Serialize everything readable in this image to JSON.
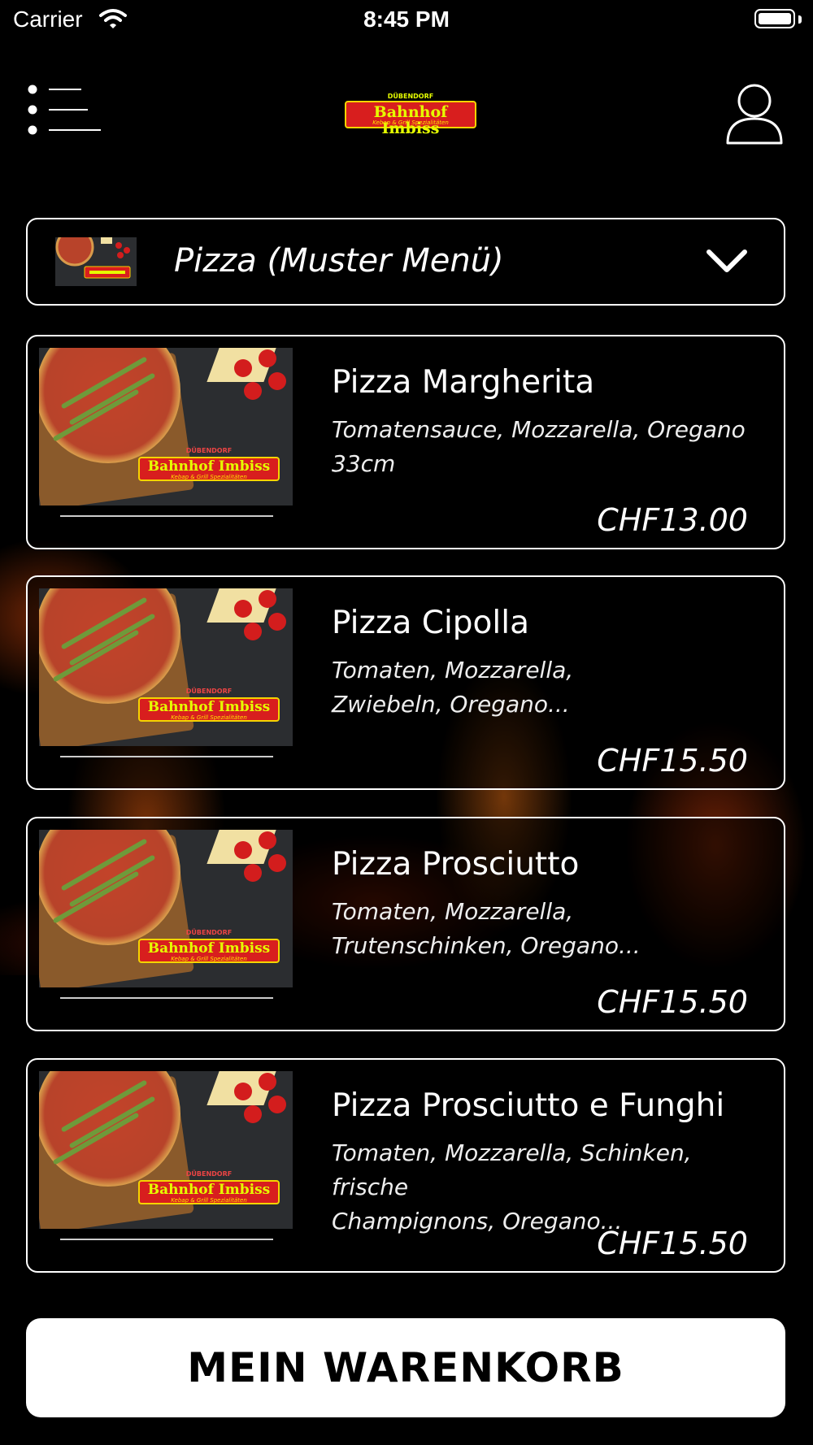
{
  "status_bar": {
    "carrier": "Carrier",
    "time": "8:45 PM"
  },
  "header": {
    "logo_top": "DÜBENDORF",
    "logo_main": "Bahnhof Imbiss",
    "logo_sub": "Kebap & Grill Spezialitäten"
  },
  "category": {
    "label": "Pizza (Muster Menü)"
  },
  "items": [
    {
      "name": "Pizza Margherita",
      "desc_line1": "Tomatensauce, Mozzarella, Oregano",
      "desc_line2": "33cm",
      "price": "CHF13.00"
    },
    {
      "name": "Pizza Cipolla",
      "desc_line1": "Tomaten, Mozzarella,",
      "desc_line2": "Zwiebeln, Oregano...",
      "price": "CHF15.50"
    },
    {
      "name": "Pizza Prosciutto",
      "desc_line1": "Tomaten, Mozzarella,",
      "desc_line2": "Trutenschinken, Oregano...",
      "price": "CHF15.50"
    },
    {
      "name": "Pizza Prosciutto e Funghi",
      "desc_line1": "Tomaten, Mozzarella, Schinken, frische",
      "desc_line2": "Champignons, Oregano...",
      "price": "CHF15.50"
    }
  ],
  "cart": {
    "label": "MEIN WARENKORB"
  },
  "icons": {
    "menu": "menu-icon",
    "profile": "user-icon",
    "dropdown": "chevron-down-icon",
    "wifi": "wifi-icon",
    "battery": "battery-icon"
  }
}
